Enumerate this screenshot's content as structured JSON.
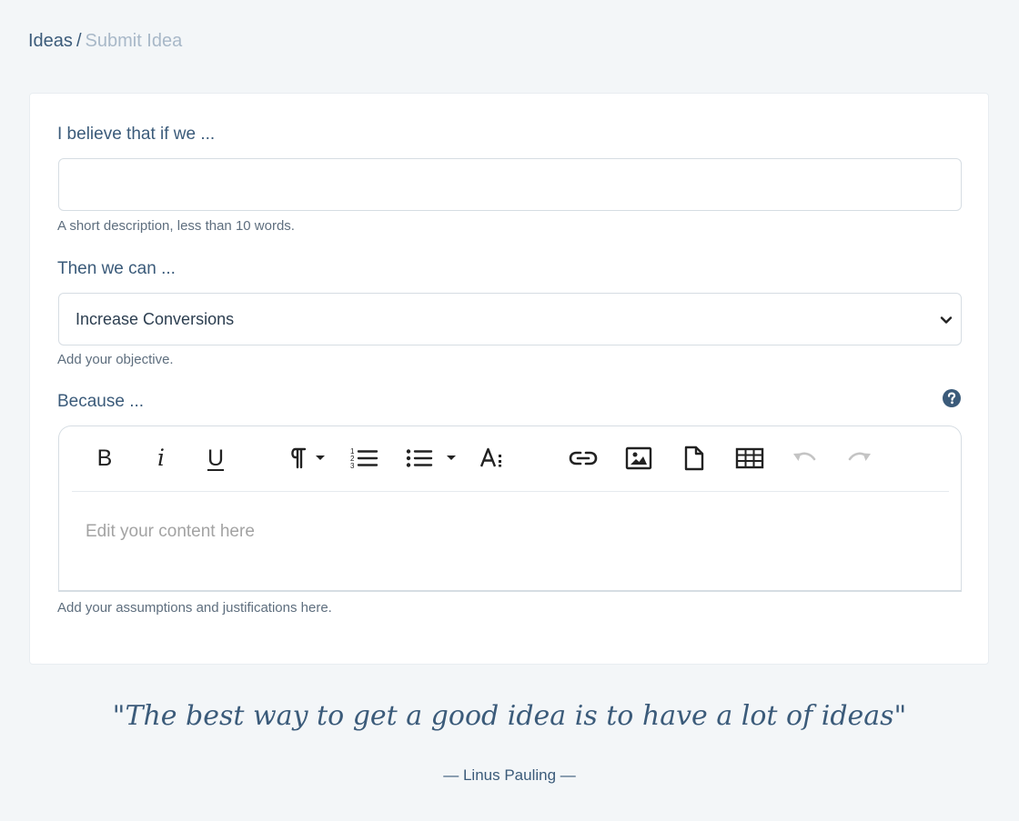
{
  "breadcrumb": {
    "parent": "Ideas",
    "separator": "/",
    "current": "Submit Idea"
  },
  "form": {
    "hypothesis": {
      "label": "I believe that if we ...",
      "value": "",
      "help": "A short description, less than 10 words."
    },
    "objective": {
      "label": "Then we can ...",
      "selected": "Increase Conversions",
      "help": "Add your objective."
    },
    "justification": {
      "label": "Because ...",
      "placeholder": "Edit your content here",
      "help": "Add your assumptions and justifications here."
    }
  },
  "toolbar": {
    "bold": "B",
    "italic": "i",
    "underline": "U",
    "icons": [
      "bold-icon",
      "italic-icon",
      "underline-icon",
      "paragraph-format-icon",
      "ordered-list-icon",
      "unordered-list-icon",
      "font-size-icon",
      "insert-link-icon",
      "insert-image-icon",
      "insert-file-icon",
      "insert-table-icon",
      "undo-icon",
      "redo-icon"
    ]
  },
  "quote": {
    "text": "\"The best way to get a good idea is to have a lot of ideas\"",
    "author": "— Linus Pauling —"
  },
  "colors": {
    "page_background": "#f3f6f8",
    "primary_text": "#3b5b7a",
    "muted_text": "#a8b8c8",
    "help_text": "#5e6e7e",
    "disabled_icon": "#c4c4c4"
  }
}
